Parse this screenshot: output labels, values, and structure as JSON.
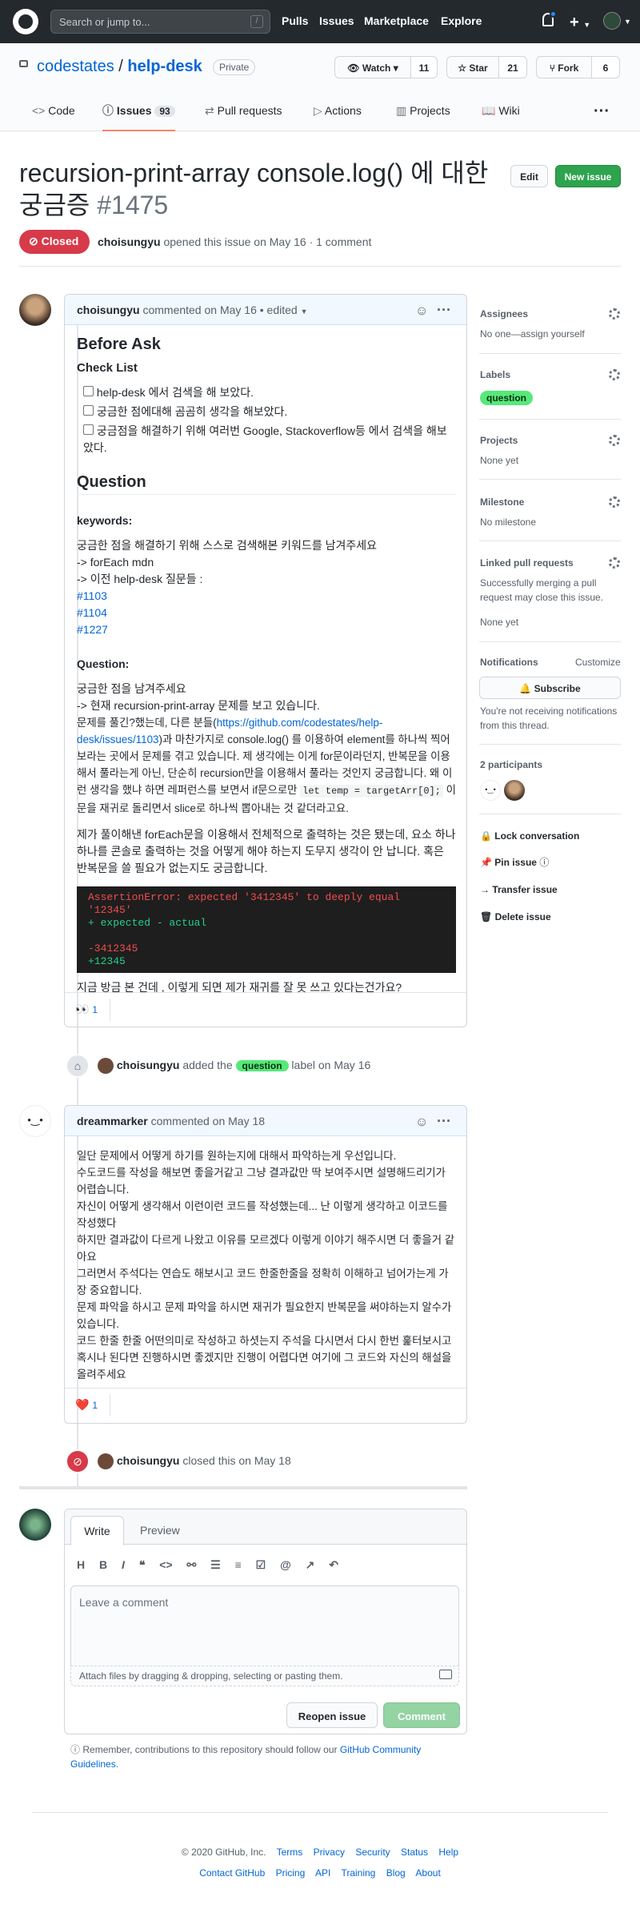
{
  "header": {
    "search_placeholder": "Search or jump to...",
    "slash": "/",
    "nav": [
      "Pulls",
      "Issues",
      "Marketplace",
      "Explore"
    ]
  },
  "repo": {
    "owner": "codestates",
    "sep": "/",
    "name": "help-desk",
    "visibility": "Private",
    "watch": "Watch",
    "watch_count": "11",
    "star": "Star",
    "star_count": "21",
    "fork": "Fork",
    "fork_count": "6"
  },
  "tabs": [
    {
      "label": "Code"
    },
    {
      "label": "Issues",
      "count": "93"
    },
    {
      "label": "Pull requests"
    },
    {
      "label": "Actions"
    },
    {
      "label": "Projects"
    },
    {
      "label": "Wiki"
    }
  ],
  "issue": {
    "title": "recursion-print-array console.log() 에 대한 궁금증",
    "number": "#1475",
    "edit": "Edit",
    "new_issue": "New issue",
    "state": "Closed",
    "author": "choisungyu",
    "meta": "opened this issue on May 16 · 1 comment"
  },
  "comment1": {
    "author": "choisungyu",
    "meta": "commented on May 16 • edited",
    "before_ask": "Before Ask",
    "checklist": "Check List",
    "checks": [
      "help-desk 에서 검색을 해 보았다.",
      "궁금한 점에대해 곰곰히 생각을 해보았다.",
      "궁금점을 해결하기 위해 여러번 Google, Stackoverflow등 에서 검색을 해보았다."
    ],
    "question_h": "Question",
    "keywords_h": "keywords:",
    "kw_text": "궁금한 점을 해결하기 위해 스스로 검색해본 키워드를 남겨주세요",
    "kw_1": "-> forEach mdn",
    "kw_2": "-> 이전 help-desk 질문들 :",
    "links": [
      "#1103",
      "#1104",
      "#1227"
    ],
    "q_h": "Question:",
    "q_1": "궁금한 점을 남겨주세요",
    "q_2": "-> 현재 recursion-print-array 문제를 보고 있습니다.",
    "q_3a": "문제를 풀긴?했는데, 다른 분들(",
    "q_link": "https://github.com/codestates/help-desk/issues/1103",
    "q_3b": ")과 마찬가지로 console.log() 를 이용하여 element를 하나씩 찍어보라는 곳에서 문제를 겪고 있습니다. 제 생각에는 이게 for문이라던지, 반복문을 이용해서 풀라는게 아닌, 단순히 recursion만을 이용해서 풀라는 것인지 궁금합니다. 왜 이런 생각을 했냐 하면 레퍼런스를 보면서 if문으로만 ",
    "q_code": "let temp = targetArr[0];",
    "q_3c": " 이 문을 재귀로 돌리면서 slice로 하나씩 뽑아내는 것 같더라고요.",
    "q_4": "제가 풀이해낸 forEach문을 이용해서 전체적으로 출력하는 것은 됐는데, 요소 하나하나를 콘솔로 출력하는 것을 어떻게 해야 하는지 도무지 생각이 안 납니다. 혹은 반복문을 쓸 필요가 없는지도 궁금합니다.",
    "code_l1": "AssertionError: expected '3412345' to deeply equal '12345'",
    "code_l2": "+ expected - actual",
    "code_l3": "-3412345",
    "code_l4": "+12345",
    "q_5": "지금 방금 본 건데 , 이렇게 되면 제가 재귀를 잘 못 쓰고 있다는건가요?",
    "reaction": "👀",
    "reaction_count": "1"
  },
  "event1": {
    "actor": "choisungyu",
    "pre": "added the",
    "label": "question",
    "post": "label on May 16"
  },
  "comment2": {
    "author": "dreammarker",
    "meta": "commented on May 18",
    "lines": [
      "일단 문제에서 어떻게 하기를 원하는지에 대해서 파악하는게 우선입니다.",
      "수도코드를 작성을 해보면 좋을거같고 그냥 결과값만 딱 보여주시면 설명해드리기가 어렵습니다.",
      "자신이 어떻게 생각해서 이런이런 코드를 작성했는데... 난 이렇게 생각하고 이코드를 작성했다",
      "하지만 결과값이 다르게 나왔고 이유를 모르겠다 이렇게 이야기 해주시면 더 좋을거 같아요",
      "그러면서 주석다는 연습도 해보시고 코드 한줄한줄을 정확히 이해하고 넘어가는게 가장 중요합니다.",
      "문제 파악을 하시고 문제 파악을 하시면 재귀가 필요한지 반복문을 써야하는지 알수가 있습니다.",
      "코드 한줄 한줄 어떤의미로 작성하고 하셧는지 주석을 다시면서 다시 한번 훑터보시고 혹시나 된다면 진행하시면 좋겠지만 진행이 어렵다면 여기에 그 코드와 자신의 해설을 올려주세요"
    ],
    "reaction": "❤️",
    "reaction_count": "1"
  },
  "event2": {
    "actor": "choisungyu",
    "text": "closed this on May 18"
  },
  "composer": {
    "write": "Write",
    "preview": "Preview",
    "placeholder": "Leave a comment",
    "attach": "Attach files by dragging & dropping, selecting or pasting them.",
    "reopen": "Reopen issue",
    "comment": "Comment",
    "note_pre": "Remember, contributions to this repository should follow our ",
    "note_link": "GitHub Community Guidelines",
    "note_post": "."
  },
  "sidebar": {
    "assignees": "Assignees",
    "assignees_val": "No one—assign yourself",
    "labels": "Labels",
    "label_val": "question",
    "projects": "Projects",
    "projects_val": "None yet",
    "milestone": "Milestone",
    "milestone_val": "No milestone",
    "linked": "Linked pull requests",
    "linked_desc": "Successfully merging a pull request may close this issue.",
    "linked_val": "None yet",
    "notifications": "Notifications",
    "customize": "Customize",
    "subscribe": "Subscribe",
    "notif_desc": "You're not receiving notifications from this thread.",
    "participants": "2 participants",
    "lock": "Lock conversation",
    "pin": "Pin issue",
    "transfer": "Transfer issue",
    "delete": "Delete issue"
  },
  "footer": {
    "copyright": "© 2020 GitHub, Inc.",
    "row1": [
      "Terms",
      "Privacy",
      "Security",
      "Status",
      "Help"
    ],
    "row2": [
      "Contact GitHub",
      "Pricing",
      "API",
      "Training",
      "Blog",
      "About"
    ]
  },
  "colors": {
    "accent": "#0366d6",
    "closed": "#d73a49",
    "green": "#2ea44f",
    "label": "#56e979"
  }
}
